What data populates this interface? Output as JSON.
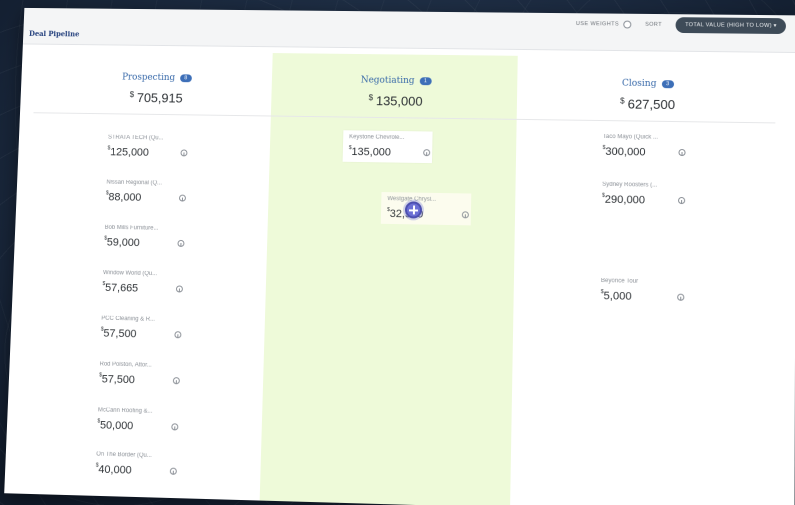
{
  "app": {
    "title": "Deal Pipeline",
    "controls": {
      "use_weights_label": "Use Weights",
      "sort_label": "Sort",
      "sort_value": "Total Value (High to Low) ▾"
    }
  },
  "columns": [
    {
      "name": "Prospecting",
      "badge": "8",
      "currency": "$",
      "total": "705,915",
      "cards": [
        {
          "title": "STRATA TECH (Qu...",
          "currency": "$",
          "value": "125,000"
        },
        {
          "title": "Nissan Regional (Q...",
          "currency": "$",
          "value": "88,000"
        },
        {
          "title": "Bob Mills Furniture...",
          "currency": "$",
          "value": "59,000"
        },
        {
          "title": "Window World (Qu...",
          "currency": "$",
          "value": "57,665"
        },
        {
          "title": "PCC Cleaning & R...",
          "currency": "$",
          "value": "57,500"
        },
        {
          "title": "Rod Polston, Attor...",
          "currency": "$",
          "value": "57,500"
        },
        {
          "title": "McCann Roofing &...",
          "currency": "$",
          "value": "50,000"
        },
        {
          "title": "On The Border (Qu...",
          "currency": "$",
          "value": "40,000"
        }
      ]
    },
    {
      "name": "Negotiating",
      "badge": "1",
      "currency": "$",
      "total": "135,000",
      "cards": [
        {
          "title": "Keystone Chevrole...",
          "currency": "$",
          "value": "135,000"
        },
        {
          "title": "Westgate Chrysl...",
          "currency": "$",
          "value": "32,500"
        }
      ]
    },
    {
      "name": "Closing",
      "badge": "3",
      "currency": "$",
      "total": "627,500",
      "cards": [
        {
          "title": "Taco Mayo (Quick ...",
          "currency": "$",
          "value": "300,000"
        },
        {
          "title": "Sydney Roosters (...",
          "currency": "$",
          "value": "290,000"
        },
        {
          "title": "Beyonce Tour",
          "currency": "$",
          "value": "5,000"
        }
      ]
    }
  ],
  "icons": {
    "info": "info-icon",
    "drag": "move-cursor-icon",
    "radio": "radio-icon"
  },
  "colors": {
    "accent": "#3d6fb8",
    "negotiating_bg": "#eefad9",
    "sort_button": "#3e4b58"
  }
}
